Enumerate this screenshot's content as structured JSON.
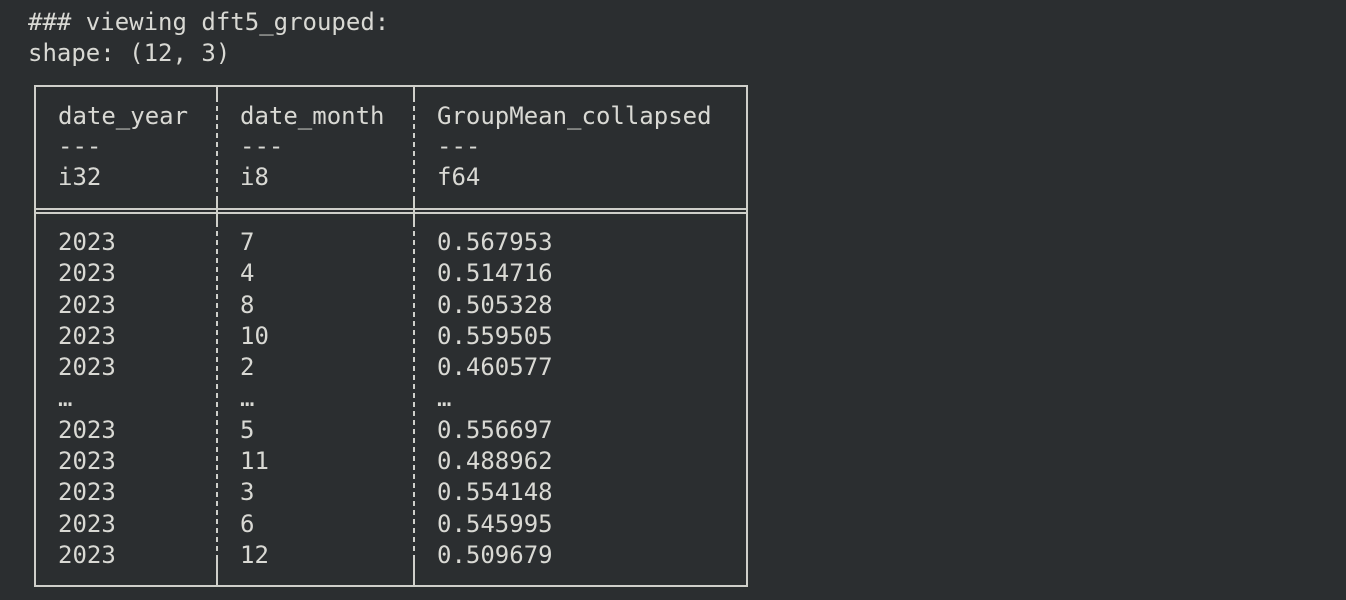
{
  "output": {
    "title_line": "### viewing dft5_grouped:",
    "shape_line": "shape: (12, 3)"
  },
  "table": {
    "columns": [
      {
        "name": "date_year",
        "rule": "---",
        "dtype": "i32"
      },
      {
        "name": "date_month",
        "rule": "---",
        "dtype": "i8"
      },
      {
        "name": "GroupMean_collapsed",
        "rule": "---",
        "dtype": "f64"
      }
    ],
    "rows": [
      [
        "2023",
        "7",
        "0.567953"
      ],
      [
        "2023",
        "4",
        "0.514716"
      ],
      [
        "2023",
        "8",
        "0.505328"
      ],
      [
        "2023",
        "10",
        "0.559505"
      ],
      [
        "2023",
        "2",
        "0.460577"
      ],
      [
        "…",
        "…",
        "…"
      ],
      [
        "2023",
        "5",
        "0.556697"
      ],
      [
        "2023",
        "11",
        "0.488962"
      ],
      [
        "2023",
        "3",
        "0.554148"
      ],
      [
        "2023",
        "6",
        "0.545995"
      ],
      [
        "2023",
        "12",
        "0.509679"
      ]
    ]
  }
}
